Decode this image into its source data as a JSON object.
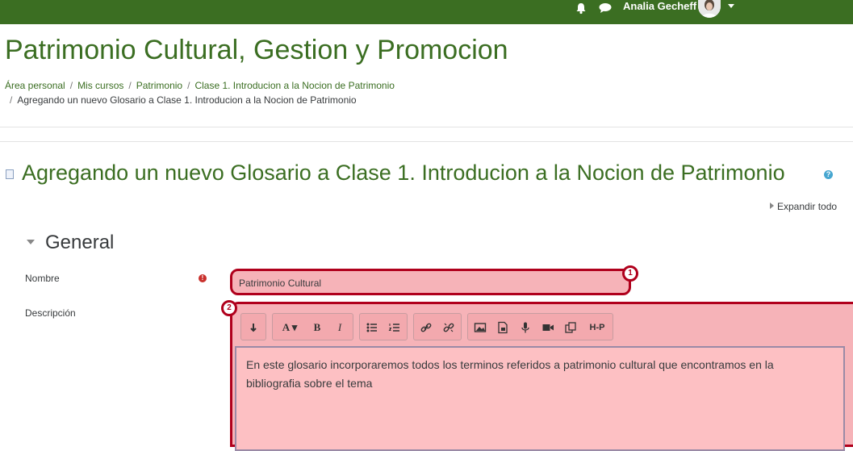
{
  "topbar": {
    "user_name": "Analia Gecheff",
    "bell_icon": "bell-icon",
    "message_icon": "chat-bubble-icon",
    "color": "#3b6e22"
  },
  "site": {
    "title": "Patrimonio Cultural, Gestion y Promocion"
  },
  "breadcrumb": {
    "items": [
      "Área personal",
      "Mis cursos",
      "Patrimonio",
      "Clase 1. Introducion a la Nocion de Patrimonio"
    ],
    "current": "Agregando un nuevo Glosario a Clase 1. Introducion a la Nocion de Patrimonio",
    "separator": "/"
  },
  "page": {
    "heading": "Agregando un nuevo Glosario a Clase 1. Introducion a la Nocion de Patrimonio",
    "help_glyph": "?",
    "expand_all": "Expandir todo"
  },
  "section": {
    "title": "General"
  },
  "form": {
    "name_label": "Nombre",
    "name_value": "Patrimonio Cultural",
    "required_glyph": "!",
    "desc_label": "Descripción",
    "desc_value": "En este glosario incorporaremos todos los terminos referidos a patrimonio cultural que encontramos en la bibliografia sobre el tema"
  },
  "toolbar": {
    "buttons": [
      "expand-toolbar",
      "font",
      "bold",
      "italic",
      "bullet-list",
      "numbered-list",
      "link",
      "unlink",
      "image",
      "media",
      "record-audio",
      "record-video",
      "manage-files",
      "h5p"
    ],
    "font_label": "A",
    "bold_label": "B",
    "italic_label": "I",
    "h5p_label": "H-P"
  },
  "annotations": {
    "badge_1": "1",
    "badge_2": "2",
    "highlight_color": "#b0001c"
  }
}
